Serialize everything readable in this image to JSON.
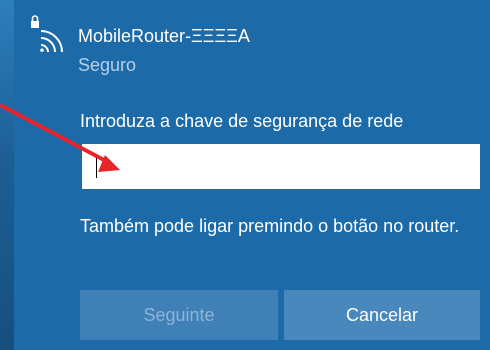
{
  "network": {
    "name": "MobileRouter-ΞΞΞΞA",
    "status": "Seguro",
    "icon": "secured-wifi-icon"
  },
  "key_prompt": {
    "label": "Introduza a chave de segurança de rede",
    "value": ""
  },
  "hint": "Também pode ligar premindo o botão no router.",
  "buttons": {
    "next_label": "Seguinte",
    "cancel_label": "Cancelar"
  },
  "annotation": {
    "icon": "red-arrow-icon",
    "color": "#e8242a"
  },
  "colors": {
    "panel": "#1c6aa8",
    "button": "#4988bd",
    "button_disabled_text": "#8fb4d6"
  }
}
